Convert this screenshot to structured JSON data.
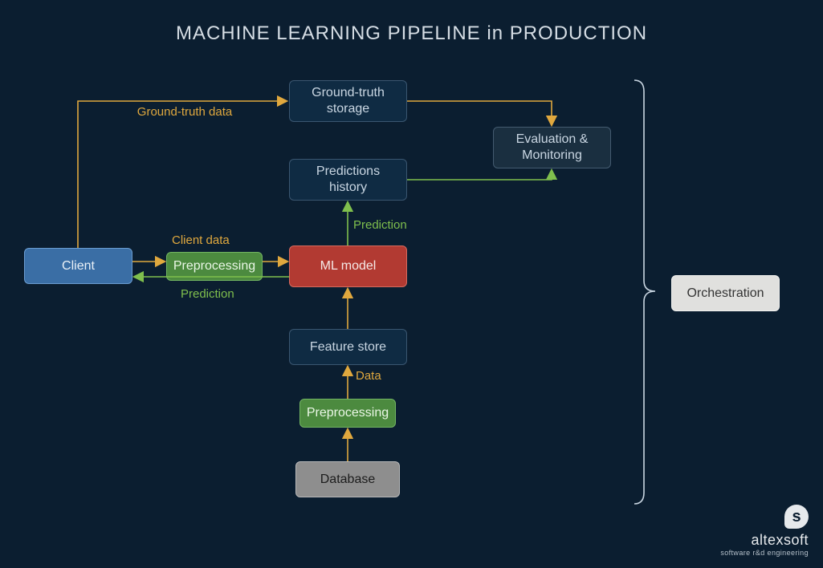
{
  "title": "MACHINE LEARNING PIPELINE in PRODUCTION",
  "nodes": {
    "client": "Client",
    "preprocessing1": "Preprocessing",
    "ml_model": "ML model",
    "ground_truth_storage": "Ground-truth storage",
    "predictions_history": "Predictions history",
    "evaluation_monitoring": "Evaluation & Monitoring",
    "feature_store": "Feature store",
    "preprocessing2": "Preprocessing",
    "database": "Database",
    "orchestration": "Orchestration"
  },
  "labels": {
    "ground_truth_data": "Ground-truth data",
    "client_data": "Client data",
    "prediction_up": "Prediction",
    "prediction_back": "Prediction",
    "data": "Data"
  },
  "brand": {
    "name": "altexsoft",
    "tagline": "software r&d engineering",
    "mark": "s"
  },
  "colors": {
    "bg": "#0b1e30",
    "yellow": "#e0a83e",
    "green_line": "#7fbf4d"
  }
}
